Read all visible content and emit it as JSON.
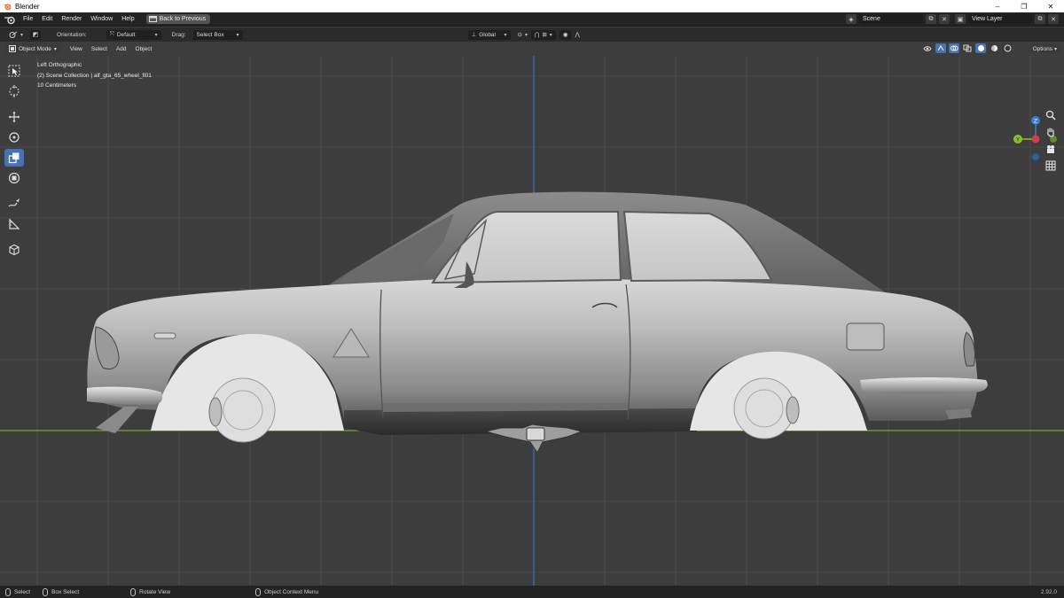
{
  "window": {
    "title": "Blender",
    "controls": [
      "–",
      "❐",
      "✕"
    ]
  },
  "menu": {
    "items": [
      "File",
      "Edit",
      "Render",
      "Window",
      "Help"
    ],
    "back_button": "Back to Previous"
  },
  "scene": {
    "scene_name": "Scene",
    "view_layer": "View Layer"
  },
  "tool_settings": {
    "orientation_label": "Orientation:",
    "orientation_value": "Default",
    "drag_label": "Drag:",
    "drag_value": "Select Box",
    "transform_orientation": "Global"
  },
  "viewport_header": {
    "mode": "Object Mode",
    "menus": [
      "View",
      "Select",
      "Add",
      "Object"
    ],
    "options": "Options"
  },
  "viewport": {
    "view_name": "Left Orthographic",
    "collection": "(2) Scene Collection | alf_gta_65_wheel_fl01",
    "scale": "10 Centimeters"
  },
  "gizmo": {
    "z": "Z",
    "y": "Y"
  },
  "status": {
    "select": "Select",
    "box_select": "Box Select",
    "rotate_view": "Rotate View",
    "context_menu": "Object Context Menu",
    "version": "2.92.0"
  },
  "colors": {
    "accent": "#4772b3",
    "axis_x": "#d33c4e",
    "axis_y": "#8ac030",
    "axis_z": "#3c7ad6",
    "grid": "#4a4a4a"
  }
}
